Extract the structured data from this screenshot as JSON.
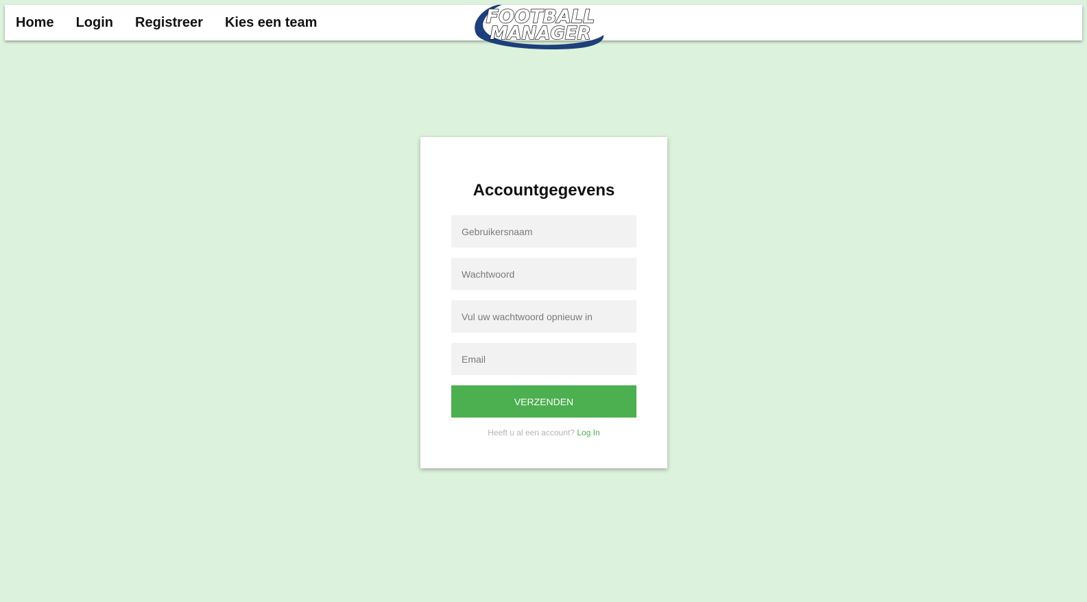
{
  "nav": {
    "items": [
      {
        "label": "Home"
      },
      {
        "label": "Login"
      },
      {
        "label": "Registreer"
      },
      {
        "label": "Kies een team"
      }
    ]
  },
  "logo": {
    "line1": "FOOTBALL",
    "line2": "MANAGER",
    "colors": {
      "swoosh": "#1d3f7a",
      "text": "#ffffff",
      "outline": "#1a1a1a"
    }
  },
  "form": {
    "title": "Accountgegevens",
    "username": {
      "placeholder": "Gebruikersnaam",
      "value": ""
    },
    "password": {
      "placeholder": "Wachtwoord",
      "value": ""
    },
    "password_repeat": {
      "placeholder": "Vul uw wachtwoord opnieuw in",
      "value": ""
    },
    "email": {
      "placeholder": "Email",
      "value": ""
    },
    "submit_label": "VERZENDEN",
    "footer_text": "Heeft u al een account?",
    "login_link": "Log In"
  },
  "colors": {
    "background": "#dcf2dc",
    "accent": "#4caf50",
    "input_bg": "#f2f2f2"
  }
}
